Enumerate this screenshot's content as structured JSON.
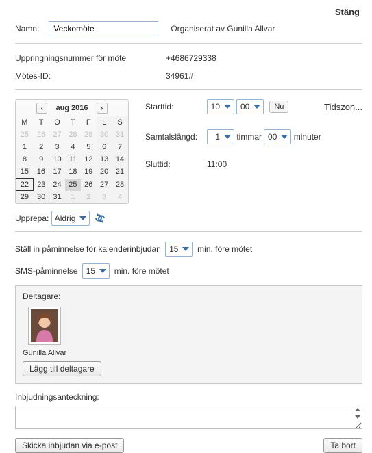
{
  "header": {
    "close_label": "Stäng"
  },
  "form": {
    "name_label": "Namn:",
    "name_value": "Veckomöte",
    "organizer_prefix": "Organiserat av",
    "organizer_name": "Gunilla Allvar",
    "dialin_label": "Uppringningsnummer för möte",
    "dialin_number": "+4686729338",
    "meeting_id_label": "Mötes-ID:",
    "meeting_id_value": "34961#"
  },
  "calendar": {
    "title": "aug 2016",
    "days": [
      "M",
      "T",
      "O",
      "T",
      "F",
      "L",
      "S"
    ],
    "rows": [
      [
        {
          "d": 25,
          "o": true
        },
        {
          "d": 26,
          "o": true
        },
        {
          "d": 27,
          "o": true
        },
        {
          "d": 28,
          "o": true
        },
        {
          "d": 29,
          "o": true
        },
        {
          "d": 30,
          "o": true,
          "w": true
        },
        {
          "d": 31,
          "o": true,
          "w": true
        }
      ],
      [
        {
          "d": 1
        },
        {
          "d": 2
        },
        {
          "d": 3
        },
        {
          "d": 4
        },
        {
          "d": 5
        },
        {
          "d": 6,
          "w": true
        },
        {
          "d": 7,
          "w": true
        }
      ],
      [
        {
          "d": 8
        },
        {
          "d": 9
        },
        {
          "d": 10
        },
        {
          "d": 11
        },
        {
          "d": 12
        },
        {
          "d": 13,
          "w": true
        },
        {
          "d": 14,
          "w": true
        }
      ],
      [
        {
          "d": 15
        },
        {
          "d": 16
        },
        {
          "d": 17
        },
        {
          "d": 18
        },
        {
          "d": 19
        },
        {
          "d": 20,
          "w": true
        },
        {
          "d": 21,
          "w": true
        }
      ],
      [
        {
          "d": 22,
          "sel": true
        },
        {
          "d": 23
        },
        {
          "d": 24
        },
        {
          "d": 25,
          "today": true
        },
        {
          "d": 26
        },
        {
          "d": 27,
          "w": true
        },
        {
          "d": 28,
          "w": true
        }
      ],
      [
        {
          "d": 29
        },
        {
          "d": 30
        },
        {
          "d": 31
        },
        {
          "d": 1,
          "o": true
        },
        {
          "d": 2,
          "o": true
        },
        {
          "d": 3,
          "o": true,
          "w": true
        },
        {
          "d": 4,
          "o": true,
          "w": true
        }
      ]
    ]
  },
  "time": {
    "start_label": "Starttid:",
    "start_hour": "10",
    "start_min": "00",
    "now_label": "Nu",
    "tz_label": "Tidszon...",
    "dur_label": "Samtalslängd:",
    "dur_hours_val": "1",
    "dur_hours_unit": "timmar",
    "dur_min_val": "00",
    "dur_min_unit": "minuter",
    "end_label": "Sluttid:",
    "end_value": "11:00"
  },
  "repeat": {
    "label": "Upprepa:",
    "value": "Aldrig"
  },
  "reminders": {
    "cal_label": "Ställ in påminnelse för kalenderinbjudan",
    "cal_value": "15",
    "cal_suffix": "min. före mötet",
    "sms_label": "SMS-påminnelse",
    "sms_value": "15",
    "sms_suffix": "min. före mötet"
  },
  "participants": {
    "heading": "Deltagare:",
    "items": [
      {
        "name": "Gunilla Allvar"
      }
    ],
    "add_label": "Lägg till deltagare"
  },
  "note": {
    "label": "Inbjudningsanteckning:",
    "value": ""
  },
  "footer": {
    "send_label": "Skicka inbjudan via e-post",
    "delete_label": "Ta bort"
  }
}
